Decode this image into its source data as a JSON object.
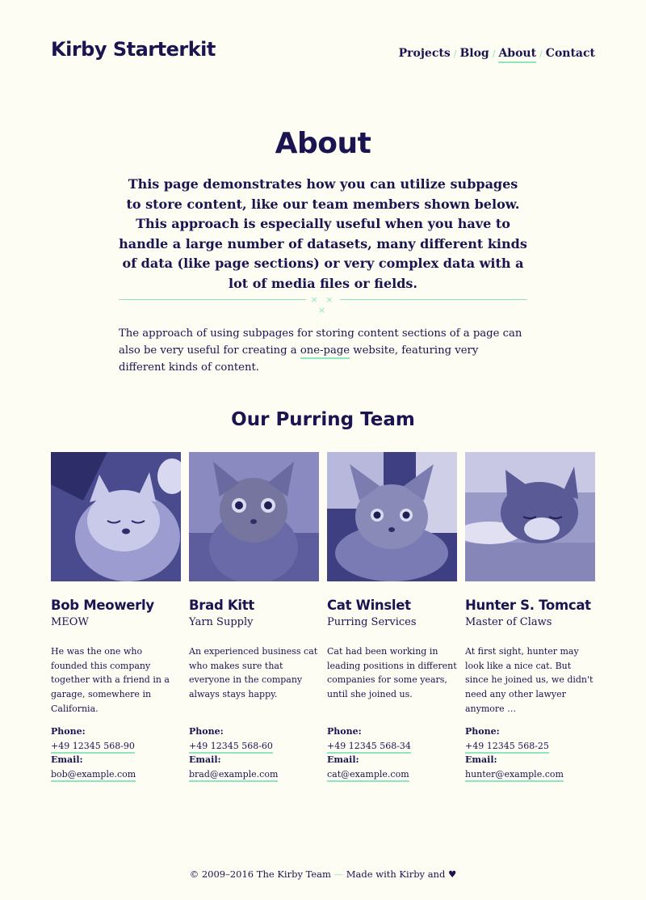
{
  "site": {
    "title": "Kirby Starterkit"
  },
  "nav": {
    "items": [
      {
        "label": "Projects"
      },
      {
        "label": "Blog"
      },
      {
        "label": "About"
      },
      {
        "label": "Contact"
      }
    ],
    "active": "About"
  },
  "page": {
    "title": "About",
    "intro": "This page demonstrates how you can utilize subpages to store content, like our team members shown below. This approach is especially useful when you have to handle a large number of datasets, many different kinds of data (like page sections) or very complex data with a lot of media files or fields.",
    "divider": "× × ×",
    "body_before": "The approach of using subpages for storing content sections of a page can also be very useful for creating a ",
    "body_link": "one-page",
    "body_after": " website, featuring very different kinds of content."
  },
  "team": {
    "title": "Our Purring Team",
    "phone_label": "Phone:",
    "email_label": "Email:",
    "members": [
      {
        "name": "Bob Meowerly",
        "role": "MEOW",
        "bio": "He was the one who founded this company together with a friend in a garage, somewhere in California.",
        "phone": "+49 12345 568-90",
        "email": "bob@example.com"
      },
      {
        "name": "Brad Kitt",
        "role": "Yarn Supply",
        "bio": "An experienced business cat who makes sure that everyone in the company always stays happy.",
        "phone": "+49 12345 568-60",
        "email": "brad@example.com"
      },
      {
        "name": "Cat Winslet",
        "role": "Purring Services",
        "bio": "Cat had been working in leading positions in different companies for some years, until she joined us.",
        "phone": "+49 12345 568-34",
        "email": "cat@example.com"
      },
      {
        "name": "Hunter S. Tomcat",
        "role": "Master of Claws",
        "bio": "At first sight, hunter may look like a nice cat. But since he joined us, we didn't need any other lawyer anymore …",
        "phone": "+49 12345 568-25",
        "email": "hunter@example.com"
      }
    ]
  },
  "footer": {
    "copyright": "© 2009–2016 The Kirby Team",
    "dash": "—",
    "made_with": "Made with Kirby and",
    "heart": "♥"
  },
  "colors": {
    "background": "#fdfdf3",
    "text": "#1a1450",
    "accent": "#8ee6bf"
  }
}
